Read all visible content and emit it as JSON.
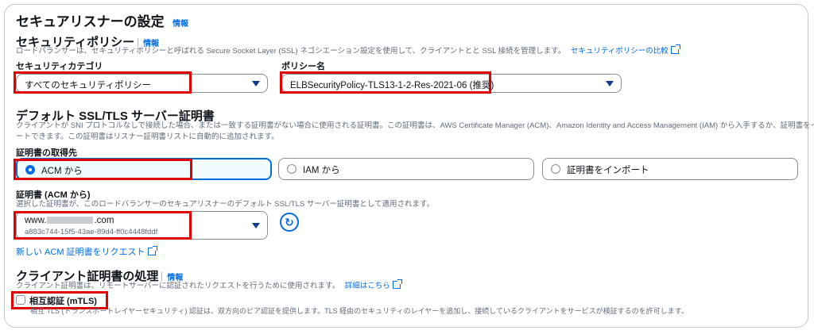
{
  "listener": {
    "title": "セキュアリスナーの設定",
    "info": "情報"
  },
  "security_policy": {
    "title": "セキュリティポリシー",
    "info": "情報",
    "description": "ロードバランサーは、セキュリティポリシーと呼ばれる Secure Socket Layer (SSL) ネゴシエーション設定を使用して、クライアントとと SSL 接続を管理します。",
    "compare_link": "セキュリティポリシーの比較",
    "category_label": "セキュリティカテゴリ",
    "category_value": "すべてのセキュリティポリシー",
    "policy_label": "ポリシー名",
    "policy_value": "ELBSecurityPolicy-TLS13-1-2-Res-2021-06 (推奨)"
  },
  "default_cert": {
    "title": "デフォルト SSL/TLS サーバー証明書",
    "description_1": "クライアントが SNI プロトコルなしで接続した場合、または一致する証明書がない場合に使用される証明書。この証明書は、AWS Certificate Manager (ACM)、Amazon Identity and Access Management (IAM) から入手するか、証明書をインポ",
    "description_2": "ートできます。この証明書はリスナー証明書リストに自動的に追加されます。",
    "source_label": "証明書の取得先",
    "options": [
      "ACM から",
      "IAM から",
      "証明書をインポート"
    ],
    "selected": "ACM から",
    "acm_label": "証明書 (ACM から)",
    "acm_desc": "選択した証明書が、このロードバランサーのセキュアリスナーのデフォルト SSL/TLS サーバー証明書として適用されます。",
    "cert_domain": "www.",
    "cert_domain_end": ".com",
    "cert_id": "a883c744-15f5-43ae-89d4-ff0c4448fddf",
    "request_link": "新しい ACM 証明書をリクエスト"
  },
  "client_cert": {
    "title": "クライアント証明書の処理",
    "info": "情報",
    "description": "クライアント証明書は、リモートサーバーに認証されたリクエストを行うために使用されます。",
    "details_link": "詳細はこちら",
    "mtls_label": "相互認証 (mTLS)",
    "mtls_desc": "相互 TLS (トランスポートレイヤーセキュリティ) 認証は、双方向のピア認証を提供します。TLS 経由のセキュリティのレイヤーを追加し、接続しているクライアントをサービスが検証するのを許可します。"
  },
  "colors": {
    "link": "#006ce0",
    "highlight_red": "#e00000",
    "selected_bg": "#f0fbff"
  }
}
